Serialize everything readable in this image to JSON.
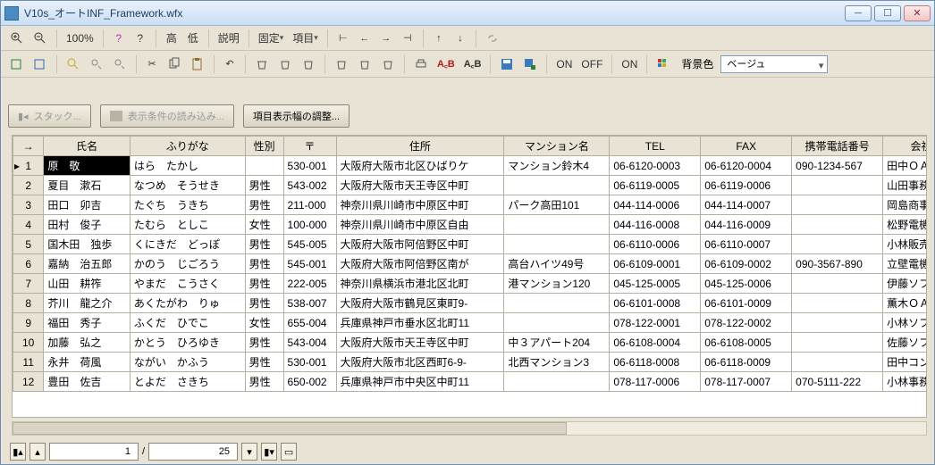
{
  "window": {
    "title": "V10s_オートINF_Framework.wfx"
  },
  "toolbar1": {
    "zoom_pct": "100%",
    "q1": "?",
    "q2": "?",
    "hi": "高",
    "lo": "低",
    "explain": "説明",
    "fixed": "固定",
    "items": "項目"
  },
  "toolbar2": {
    "on1": "ON",
    "off1": "OFF",
    "on2": "ON",
    "bg_label": "背景色",
    "bg_value": "ベージュ"
  },
  "actions": {
    "stack": "スタック...",
    "load_cond": "表示条件の読み込み...",
    "adjust_widths": "項目表示幅の調整..."
  },
  "columns": [
    "→",
    "氏名",
    "ふりがな",
    "性別",
    "〒",
    "住所",
    "マンション名",
    "TEL",
    "FAX",
    "携帯電話番号",
    "会社"
  ],
  "rows": [
    {
      "n": "1",
      "name": "原　敬",
      "kana": "はら　たかし",
      "sex": "",
      "zip": "530-001",
      "addr": "大阪府大阪市北区ひばりケ",
      "man": "マンション鈴木4",
      "tel": "06-6120-0003",
      "fax": "06-6120-0004",
      "mob": "090-1234-567",
      "co": "田中ＯＡ販"
    },
    {
      "n": "2",
      "name": "夏目　漱石",
      "kana": "なつめ　そうせき",
      "sex": "男性",
      "zip": "543-002",
      "addr": "大阪府大阪市天王寺区中町",
      "man": "",
      "tel": "06-6119-0005",
      "fax": "06-6119-0006",
      "mob": "",
      "co": "山田事務機"
    },
    {
      "n": "3",
      "name": "田口　卯吉",
      "kana": "たぐち　うきち",
      "sex": "男性",
      "zip": "211-000",
      "addr": "神奈川県川崎市中原区中町",
      "man": "パーク高田101",
      "tel": "044-114-0006",
      "fax": "044-114-0007",
      "mob": "",
      "co": "岡島商事"
    },
    {
      "n": "4",
      "name": "田村　俊子",
      "kana": "たむら　としこ",
      "sex": "女性",
      "zip": "100-000",
      "addr": "神奈川県川崎市中原区自由",
      "man": "",
      "tel": "044-116-0008",
      "fax": "044-116-0009",
      "mob": "",
      "co": "松野電機事"
    },
    {
      "n": "5",
      "name": "国木田　独歩",
      "kana": "くにきだ　どっぽ",
      "sex": "男性",
      "zip": "545-005",
      "addr": "大阪府大阪市阿倍野区中町",
      "man": "",
      "tel": "06-6110-0006",
      "fax": "06-6110-0007",
      "mob": "",
      "co": "小林販売株"
    },
    {
      "n": "6",
      "name": "嘉納　治五郎",
      "kana": "かのう　じごろう",
      "sex": "男性",
      "zip": "545-001",
      "addr": "大阪府大阪市阿倍野区南が",
      "man": "高台ハイツ49号",
      "tel": "06-6109-0001",
      "fax": "06-6109-0002",
      "mob": "090-3567-890",
      "co": "立壁電機商"
    },
    {
      "n": "7",
      "name": "山田　耕筰",
      "kana": "やまだ　こうさく",
      "sex": "男性",
      "zip": "222-005",
      "addr": "神奈川県横浜市港北区北町",
      "man": "港マンション120",
      "tel": "045-125-0005",
      "fax": "045-125-0006",
      "mob": "",
      "co": "伊藤ソフト"
    },
    {
      "n": "8",
      "name": "芥川　龍之介",
      "kana": "あくたがわ　りゅ",
      "sex": "男性",
      "zip": "538-007",
      "addr": "大阪府大阪市鶴見区東町9-",
      "man": "",
      "tel": "06-6101-0008",
      "fax": "06-6101-0009",
      "mob": "",
      "co": "薫木ＯＡ販"
    },
    {
      "n": "9",
      "name": "福田　秀子",
      "kana": "ふくだ　ひでこ",
      "sex": "女性",
      "zip": "655-004",
      "addr": "兵庫県神戸市垂水区北町11",
      "man": "",
      "tel": "078-122-0001",
      "fax": "078-122-0002",
      "mob": "",
      "co": "小林ソフト"
    },
    {
      "n": "10",
      "name": "加藤　弘之",
      "kana": "かとう　ひろゆき",
      "sex": "男性",
      "zip": "543-004",
      "addr": "大阪府大阪市天王寺区中町",
      "man": "中３アパート204",
      "tel": "06-6108-0004",
      "fax": "06-6108-0005",
      "mob": "",
      "co": "佐藤ソフト"
    },
    {
      "n": "11",
      "name": "永井　荷風",
      "kana": "ながい　かふう",
      "sex": "男性",
      "zip": "530-001",
      "addr": "大阪府大阪市北区西町6-9-",
      "man": "北西マンション3",
      "tel": "06-6118-0008",
      "fax": "06-6118-0009",
      "mob": "",
      "co": "田中コンピ"
    },
    {
      "n": "12",
      "name": "豊田　佐吉",
      "kana": "とよだ　さきち",
      "sex": "男性",
      "zip": "650-002",
      "addr": "兵庫県神戸市中央区中町11",
      "man": "",
      "tel": "078-117-0006",
      "fax": "078-117-0007",
      "mob": "070-5111-222",
      "co": "小林事務機"
    }
  ],
  "status": {
    "current": "1",
    "sep": "/",
    "total": "25"
  }
}
